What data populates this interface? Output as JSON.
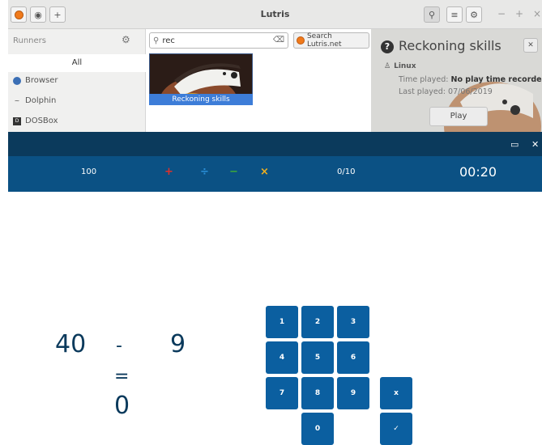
{
  "lutris": {
    "title": "Lutris",
    "add_label": "+",
    "win_controls": {
      "minimize": "−",
      "maximize": "+",
      "close": "×"
    },
    "sidebar": {
      "header": "Runners",
      "all_label": "All",
      "runners": [
        {
          "label": "Browser",
          "icon": "globe-icon"
        },
        {
          "label": "Dolphin",
          "icon": "dolphin-icon"
        },
        {
          "label": "DOSBox",
          "icon": "dosbox-icon"
        }
      ]
    },
    "search": {
      "value": "rec",
      "placeholder": "",
      "net_label": "Search Lutris.net"
    },
    "game_tile": {
      "label": "Reckoning skills"
    },
    "panel": {
      "title": "Reckoning skills",
      "platform": "Linux",
      "time_played_label": "Time played:",
      "time_played_value": "No play time recorded",
      "last_played_label": "Last played:",
      "last_played_value": "07/06/2019",
      "play_label": "Play"
    }
  },
  "game": {
    "score": "100",
    "operators": [
      {
        "symbol": "+",
        "color": "#e0302a"
      },
      {
        "symbol": "÷",
        "color": "#2a8fd8"
      },
      {
        "symbol": "−",
        "color": "#3daa3a"
      },
      {
        "symbol": "×",
        "color": "#f2b01e"
      }
    ],
    "progress": "0/10",
    "timer": "00:20",
    "equation": {
      "left": "40",
      "op": "-",
      "right": "9",
      "equals": "=",
      "answer": "0"
    },
    "keypad": [
      "1",
      "2",
      "3",
      "4",
      "5",
      "6",
      "7",
      "8",
      "9",
      "0"
    ],
    "clear_label": "x",
    "submit_label": "✓"
  }
}
